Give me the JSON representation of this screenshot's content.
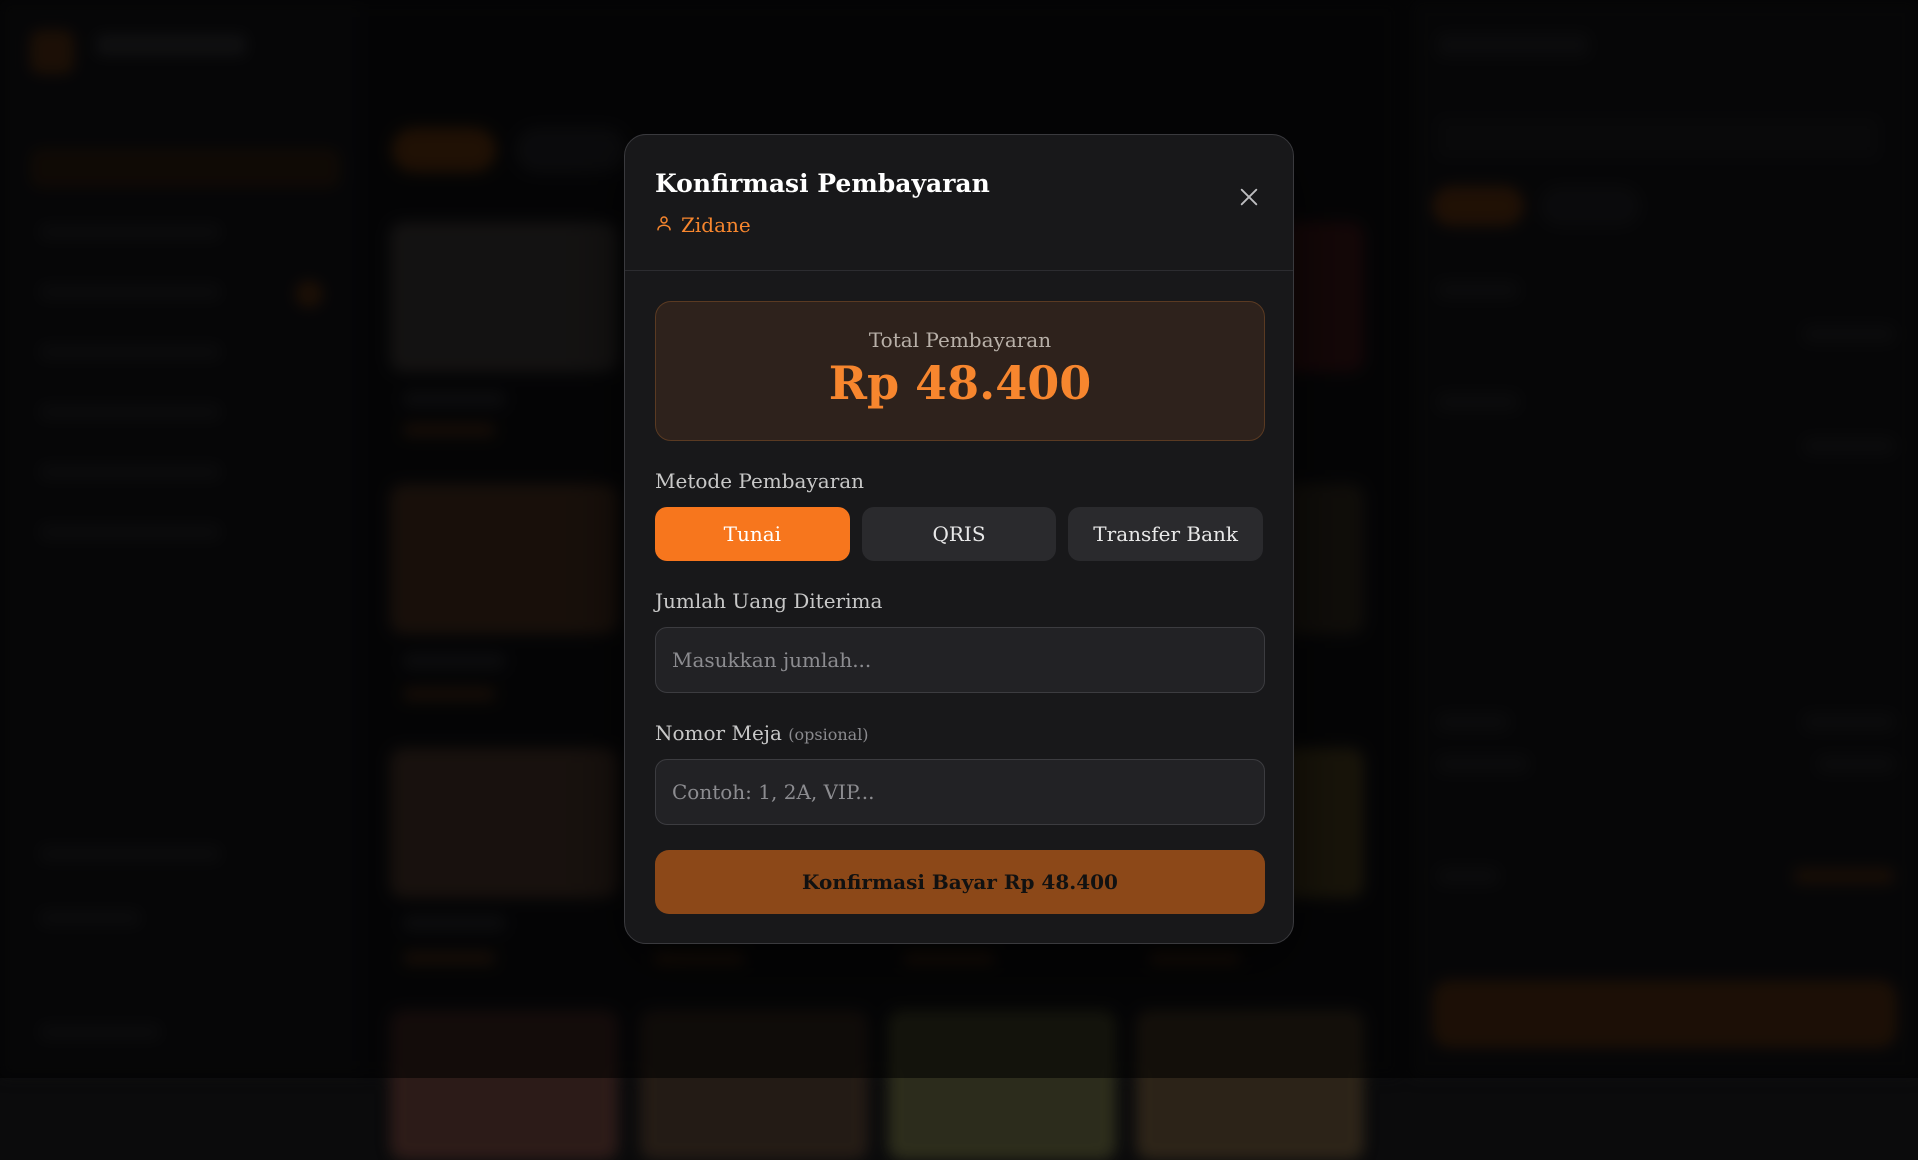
{
  "modal": {
    "title": "Konfirmasi Pembayaran",
    "customer_name": "Zidane",
    "total_label": "Total Pembayaran",
    "total_amount": "Rp 48.400",
    "payment_method_label": "Metode Pembayaran",
    "payment_methods": [
      {
        "label": "Tunai",
        "selected": true
      },
      {
        "label": "QRIS",
        "selected": false
      },
      {
        "label": "Transfer Bank",
        "selected": false
      }
    ],
    "amount_received_label": "Jumlah Uang Diterima",
    "amount_received_placeholder": "Masukkan jumlah...",
    "table_number_label": "Nomor Meja",
    "table_number_optional": "(opsional)",
    "table_number_placeholder": "Contoh: 1, 2A, VIP...",
    "confirm_button_label": "Konfirmasi Bayar Rp 48.400"
  },
  "colors": {
    "accent": "#f7761d",
    "accent_text": "#f7862e",
    "confirm_button": "#8c4818",
    "modal_bg": "#18181a"
  },
  "icons": {
    "customer": "user-icon",
    "close": "close-icon"
  }
}
